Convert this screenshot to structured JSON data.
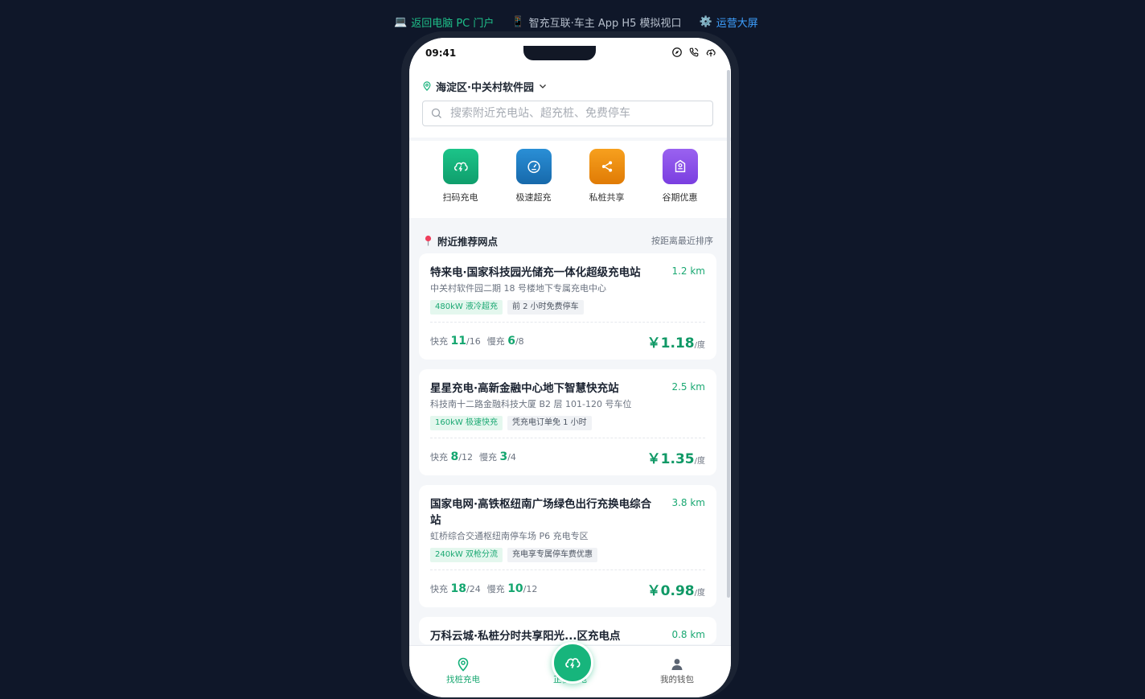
{
  "topbar": {
    "back_icon": "laptop-emoji",
    "back_label": "返回电脑 PC 门户",
    "app_icon": "mobile-emoji",
    "app_label": "智充互联·车主 App H5 模拟视口",
    "ops_icon": "gear-emoji",
    "ops_label": "运营大屏"
  },
  "status_bar": {
    "time": "09:41"
  },
  "header": {
    "location": "海淀区·中关村软件园",
    "search_placeholder": "搜索附近充电站、超充桩、免费停车"
  },
  "quick_actions": [
    {
      "label": "扫码充电",
      "icon": "cloud-bolt-icon",
      "color": "#14b07a"
    },
    {
      "label": "极速超充",
      "icon": "gauge-icon",
      "color": "#1f7fc4"
    },
    {
      "label": "私桩共享",
      "icon": "share-icon",
      "color": "#f08a0a"
    },
    {
      "label": "谷期优惠",
      "icon": "coupon-icon",
      "color": "#8a4fe6"
    }
  ],
  "nearby": {
    "title": "附近推荐网点",
    "sort_label": "按距离最近排序"
  },
  "stations": [
    {
      "name": "特来电·国家科技园光储充一体化超级充电站",
      "distance": "1.2 km",
      "address": "中关村软件园二期 18 号楼地下专属充电中心",
      "tag_power": "480kW 液冷超充",
      "tag_perk": "前 2 小时免费停车",
      "fast_label": "快充",
      "fast_free": "11",
      "fast_total": "/16",
      "slow_label": "慢充",
      "slow_free": "6",
      "slow_total": "/8",
      "price": "￥1.18",
      "unit": "/度"
    },
    {
      "name": "星星充电·高新金融中心地下智慧快充站",
      "distance": "2.5 km",
      "address": "科技南十二路金融科技大厦 B2 层 101-120 号车位",
      "tag_power": "160kW 极速快充",
      "tag_perk": "凭充电订单免 1 小时",
      "fast_label": "快充",
      "fast_free": "8",
      "fast_total": "/12",
      "slow_label": "慢充",
      "slow_free": "3",
      "slow_total": "/4",
      "price": "￥1.35",
      "unit": "/度"
    },
    {
      "name": "国家电网·高铁枢纽南广场绿色出行充换电综合站",
      "distance": "3.8 km",
      "address": "虹桥综合交通枢纽南停车场 P6 充电专区",
      "tag_power": "240kW 双枪分流",
      "tag_perk": "充电享专属停车费优惠",
      "fast_label": "快充",
      "fast_free": "18",
      "fast_total": "/24",
      "slow_label": "慢充",
      "slow_free": "10",
      "slow_total": "/12",
      "price": "￥0.98",
      "unit": "/度"
    },
    {
      "name": "万科云城·私桩分时共享阳光...区充电点",
      "distance": "0.8 km"
    }
  ],
  "tabbar": {
    "find": "找桩充电",
    "charging": "正在充电",
    "wallet": "我的钱包"
  },
  "colors": {
    "accent": "#14b07a",
    "page_bg": "#0f1729"
  }
}
